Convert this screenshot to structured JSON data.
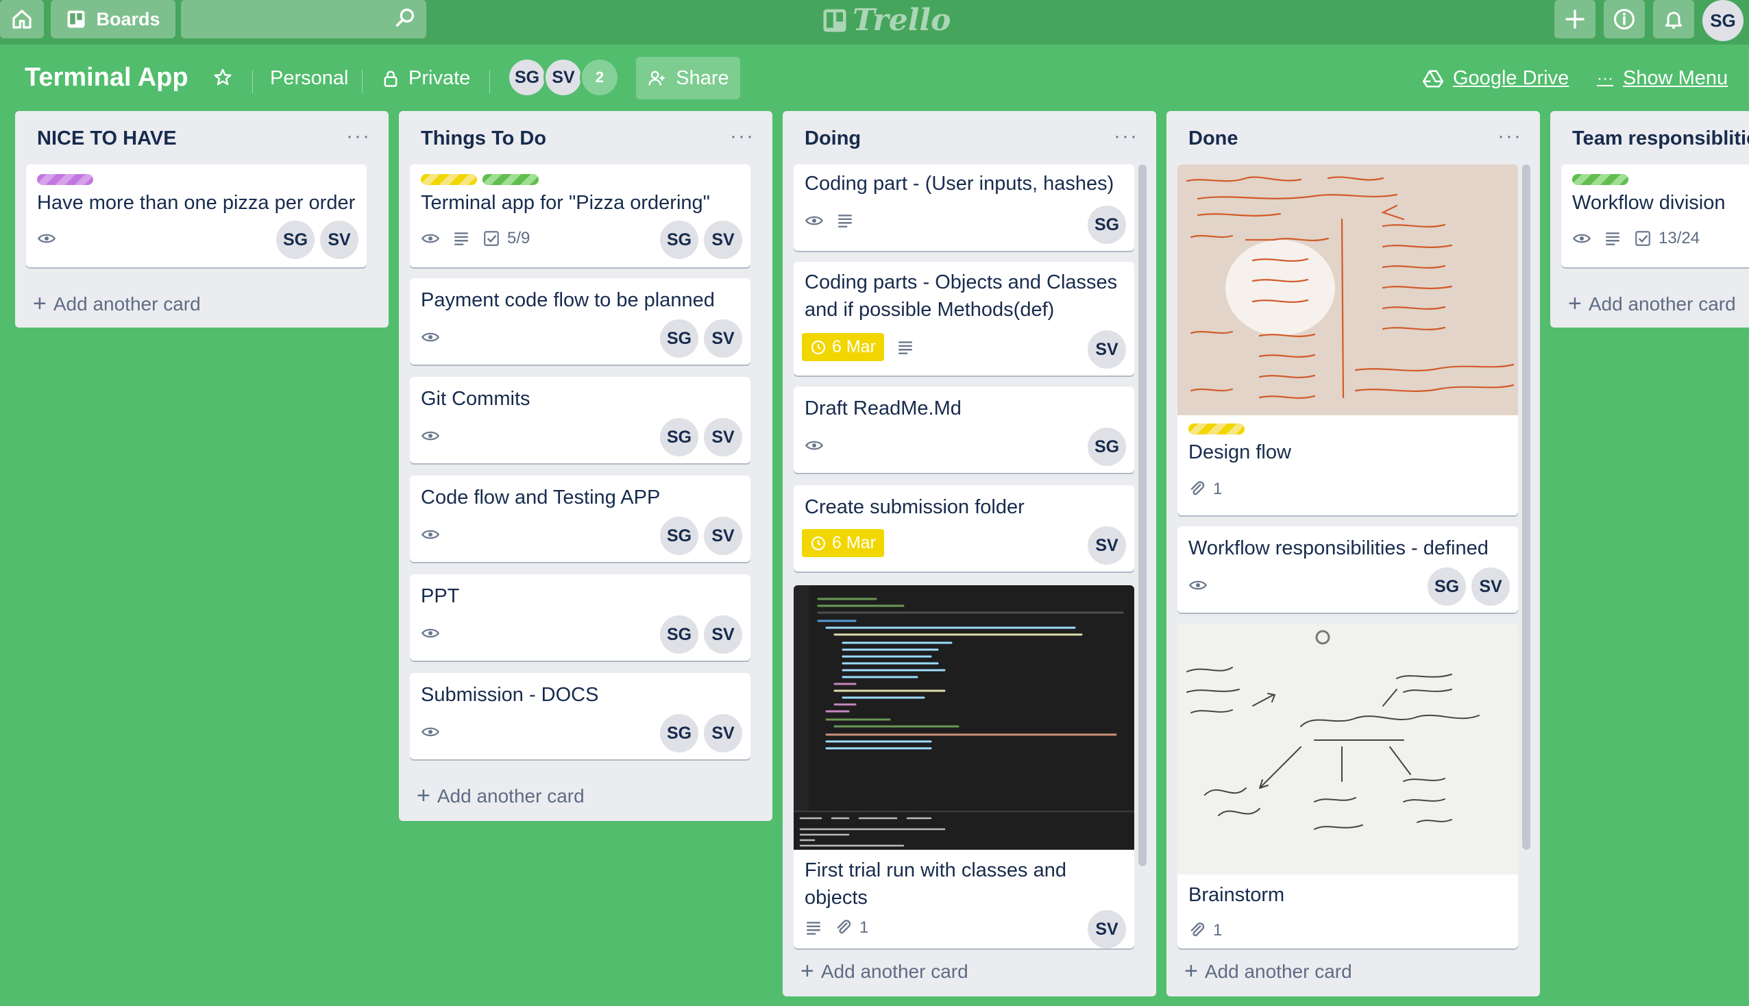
{
  "topbar": {
    "boards_label": "Boards",
    "logo_text": "Trello",
    "user_initials": "SG"
  },
  "board": {
    "title": "Terminal App",
    "team": "Personal",
    "visibility": "Private",
    "members": [
      "SG",
      "SV"
    ],
    "extra_members": "2",
    "share_label": "Share",
    "drive_label": "Google Drive",
    "menu_label": "Show Menu"
  },
  "lists": {
    "nice": {
      "title": "NICE TO HAVE",
      "add": "Add another card",
      "cards": [
        {
          "title": "Have more than one pizza per order",
          "labels": [
            "purple"
          ],
          "members": [
            "SG",
            "SV"
          ]
        }
      ]
    },
    "todo": {
      "title": "Things To Do",
      "add": "Add another card",
      "cards": [
        {
          "title": "Terminal app for \"Pizza ordering\"",
          "labels": [
            "yellow",
            "green"
          ],
          "checklist": "5/9",
          "members": [
            "SG",
            "SV"
          ]
        },
        {
          "title": "Payment code flow to be planned",
          "members": [
            "SG",
            "SV"
          ]
        },
        {
          "title": "Git Commits",
          "members": [
            "SG",
            "SV"
          ]
        },
        {
          "title": "Code flow and Testing APP",
          "members": [
            "SG",
            "SV"
          ]
        },
        {
          "title": "PPT",
          "members": [
            "SG",
            "SV"
          ]
        },
        {
          "title": "Submission - DOCS",
          "members": [
            "SG",
            "SV"
          ]
        }
      ]
    },
    "doing": {
      "title": "Doing",
      "add": "Add another card",
      "cards": [
        {
          "title": "Coding part - (User inputs, hashes)",
          "members": [
            "SG"
          ]
        },
        {
          "title_l1": "Coding parts - Objects and Classes",
          "title_l2": "and if possible Methods(def)",
          "due": "6 Mar",
          "members": [
            "SV"
          ]
        },
        {
          "title": "Draft ReadMe.Md",
          "members": [
            "SG"
          ]
        },
        {
          "title": "Create submission folder",
          "due": "6 Mar",
          "members": [
            "SV"
          ]
        },
        {
          "title_l1": "First trial run with classes and",
          "title_l2": "objects",
          "attachments": "1",
          "members": [
            "SV"
          ]
        }
      ]
    },
    "done": {
      "title": "Done",
      "add": "Add another card",
      "cards": [
        {
          "title": "Design flow",
          "labels": [
            "yellow"
          ],
          "attachments": "1"
        },
        {
          "title": "Workflow responsibilities - defined",
          "members": [
            "SG",
            "SV"
          ]
        },
        {
          "title": "Brainstorm",
          "attachments": "1"
        }
      ]
    },
    "team": {
      "title": "Team responsiblities",
      "add": "Add another card",
      "cards": [
        {
          "title": "Workflow division",
          "labels": [
            "green"
          ],
          "checklist": "13/24"
        }
      ]
    }
  },
  "colors": {
    "board_bg": "#52bd6d",
    "topbar": "#45a55c",
    "due": "#f2d600"
  }
}
